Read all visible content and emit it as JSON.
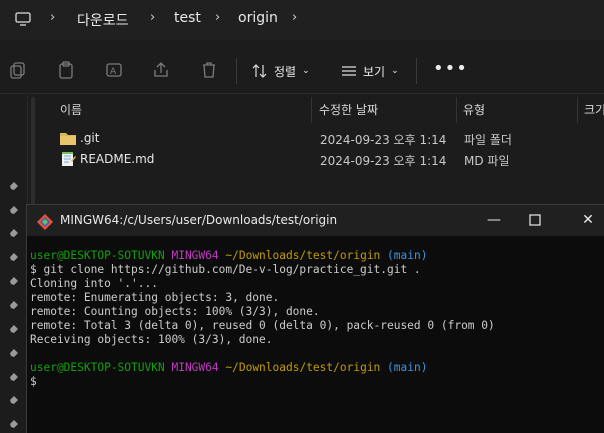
{
  "explorer": {
    "breadcrumb": [
      "다운로드",
      "test",
      "origin"
    ],
    "toolbar": {
      "sort_label": "정렬",
      "view_label": "보기",
      "more_label": "•••"
    },
    "columns": [
      "이름",
      "수정한 날짜",
      "유형",
      "크기"
    ],
    "files": [
      {
        "name": ".git",
        "date": "2024-09-23 오후 1:14",
        "type": "파일 폴더",
        "icon": "folder-icon"
      },
      {
        "name": "README.md",
        "date": "2024-09-23 오후 1:14",
        "type": "MD 파일",
        "icon": "notepad-file-icon"
      }
    ]
  },
  "terminal": {
    "title": "MINGW64:/c/Users/user/Downloads/test/origin",
    "prompt1": {
      "userhost": "user@DESKTOP-SOTUVKN",
      "shell": "MINGW64",
      "path": "~/Downloads/test/origin",
      "branch": "(main)"
    },
    "command": "$ git clone https://github.com/De-v-log/practice_git.git .",
    "output": [
      "Cloning into '.'...",
      "remote: Enumerating objects: 3, done.",
      "remote: Counting objects: 100% (3/3), done.",
      "remote: Total 3 (delta 0), reused 0 (delta 0), pack-reused 0 (from 0)",
      "Receiving objects: 100% (3/3), done."
    ],
    "prompt2": {
      "userhost": "user@DESKTOP-SOTUVKN",
      "shell": "MINGW64",
      "path": "~/Downloads/test/origin",
      "branch": "(main)"
    },
    "cursor_line": "$"
  },
  "colors": {
    "green": "#13a10e",
    "magenta": "#c239c3",
    "yellow": "#c19c00",
    "cyan": "#3a96dd",
    "folder": "#dcb45a"
  }
}
